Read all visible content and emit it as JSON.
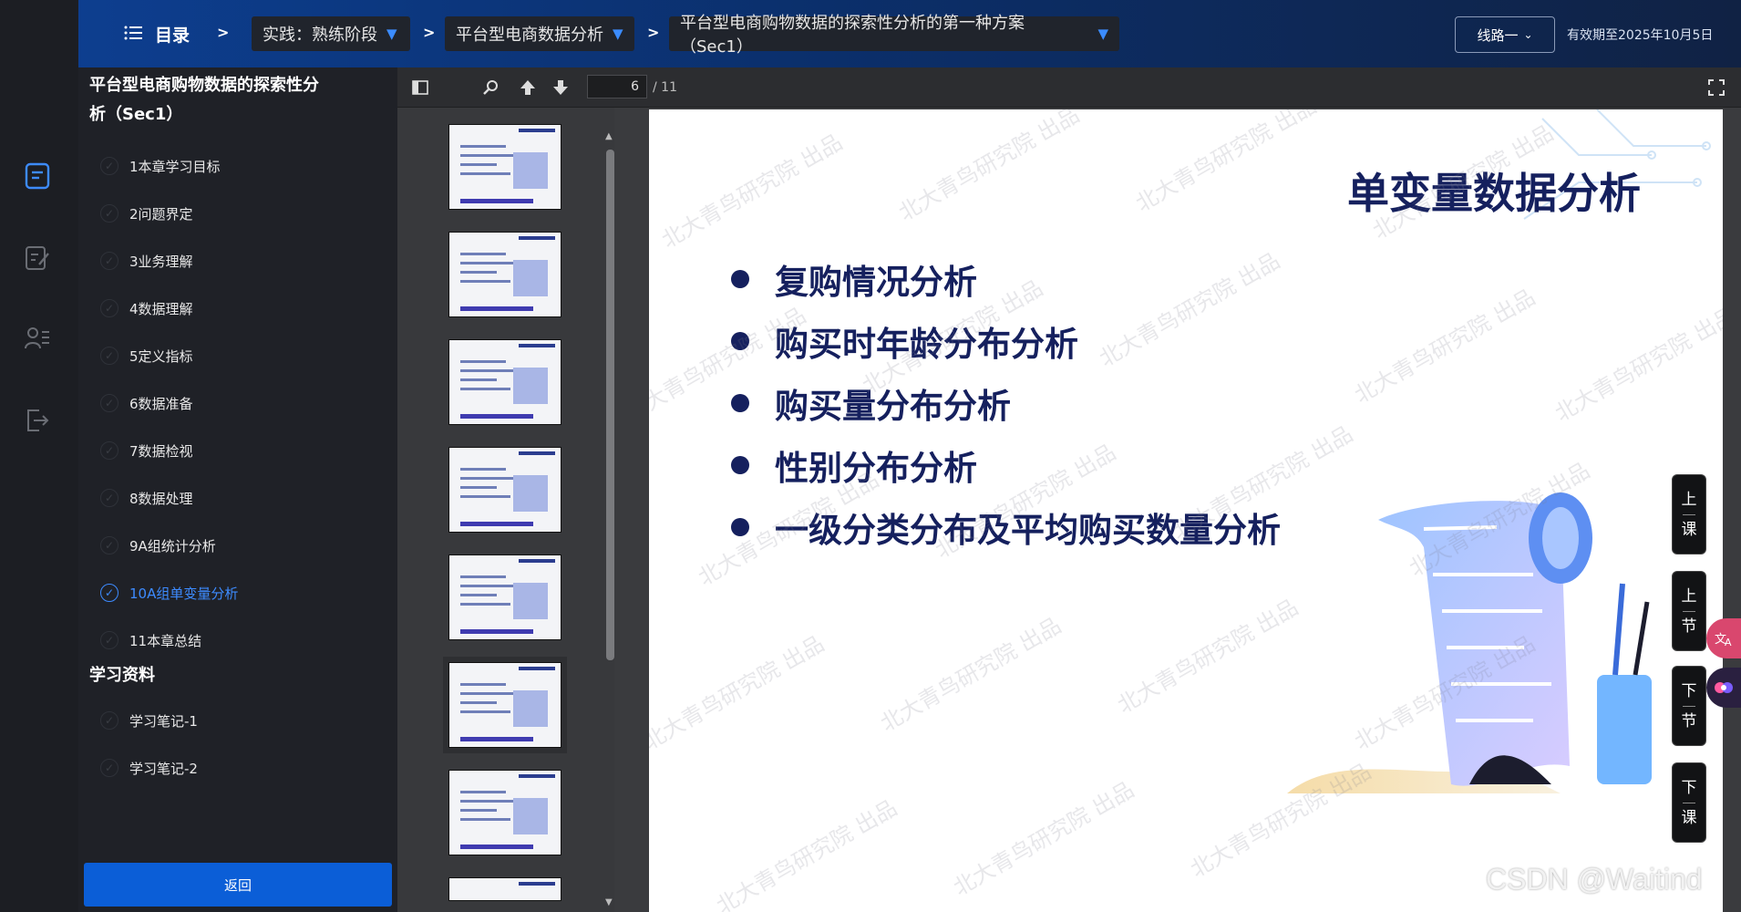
{
  "topbar": {
    "menu_title": "目录",
    "sep": ">",
    "crumbs": [
      "实践：熟练阶段",
      "平台型电商数据分析",
      "平台型电商购物数据的探索性分析的第一种方案（Sec1）"
    ],
    "route_label": "线路一",
    "valid_until": "有效期至2025年10月5日"
  },
  "catalog": {
    "title": "平台型电商购物数据的探索性分析（Sec1）",
    "items": [
      {
        "label": "1本章学习目标",
        "active": false
      },
      {
        "label": "2问题界定",
        "active": false
      },
      {
        "label": "3业务理解",
        "active": false
      },
      {
        "label": "4数据理解",
        "active": false
      },
      {
        "label": "5定义指标",
        "active": false
      },
      {
        "label": "6数据准备",
        "active": false
      },
      {
        "label": "7数据检视",
        "active": false
      },
      {
        "label": "8数据处理",
        "active": false
      },
      {
        "label": "9A组统计分析",
        "active": false
      },
      {
        "label": "10A组单变量分析",
        "active": true
      },
      {
        "label": "11本章总结",
        "active": false
      }
    ],
    "resources_title": "学习资料",
    "resources": [
      "学习笔记-1",
      "学习笔记-2"
    ],
    "back_label": "返回"
  },
  "viewer": {
    "page_current": "6",
    "page_total": "/ 11",
    "thumbnail_count": 8,
    "selected_thumbnail": 6
  },
  "slide": {
    "title": "单变量数据分析",
    "bullets": [
      "复购情况分析",
      "购买时年龄分布分析",
      "购买量分布分析",
      "性别分布分析",
      "一级分类分布及平均购买数量分析"
    ],
    "watermark": "北大青鸟研究院 出品"
  },
  "side_nav": {
    "prev_lesson": [
      "上",
      "课"
    ],
    "prev_section": [
      "上",
      "节"
    ],
    "next_section": [
      "下",
      "节"
    ],
    "next_lesson": [
      "下",
      "课"
    ]
  },
  "csdn_mark": "CSDN @Waitind",
  "colors": {
    "accent": "#3d8bff",
    "back_button": "#0b5ed7",
    "slide_text": "#15205e",
    "topbar": "#0d3e8f"
  }
}
